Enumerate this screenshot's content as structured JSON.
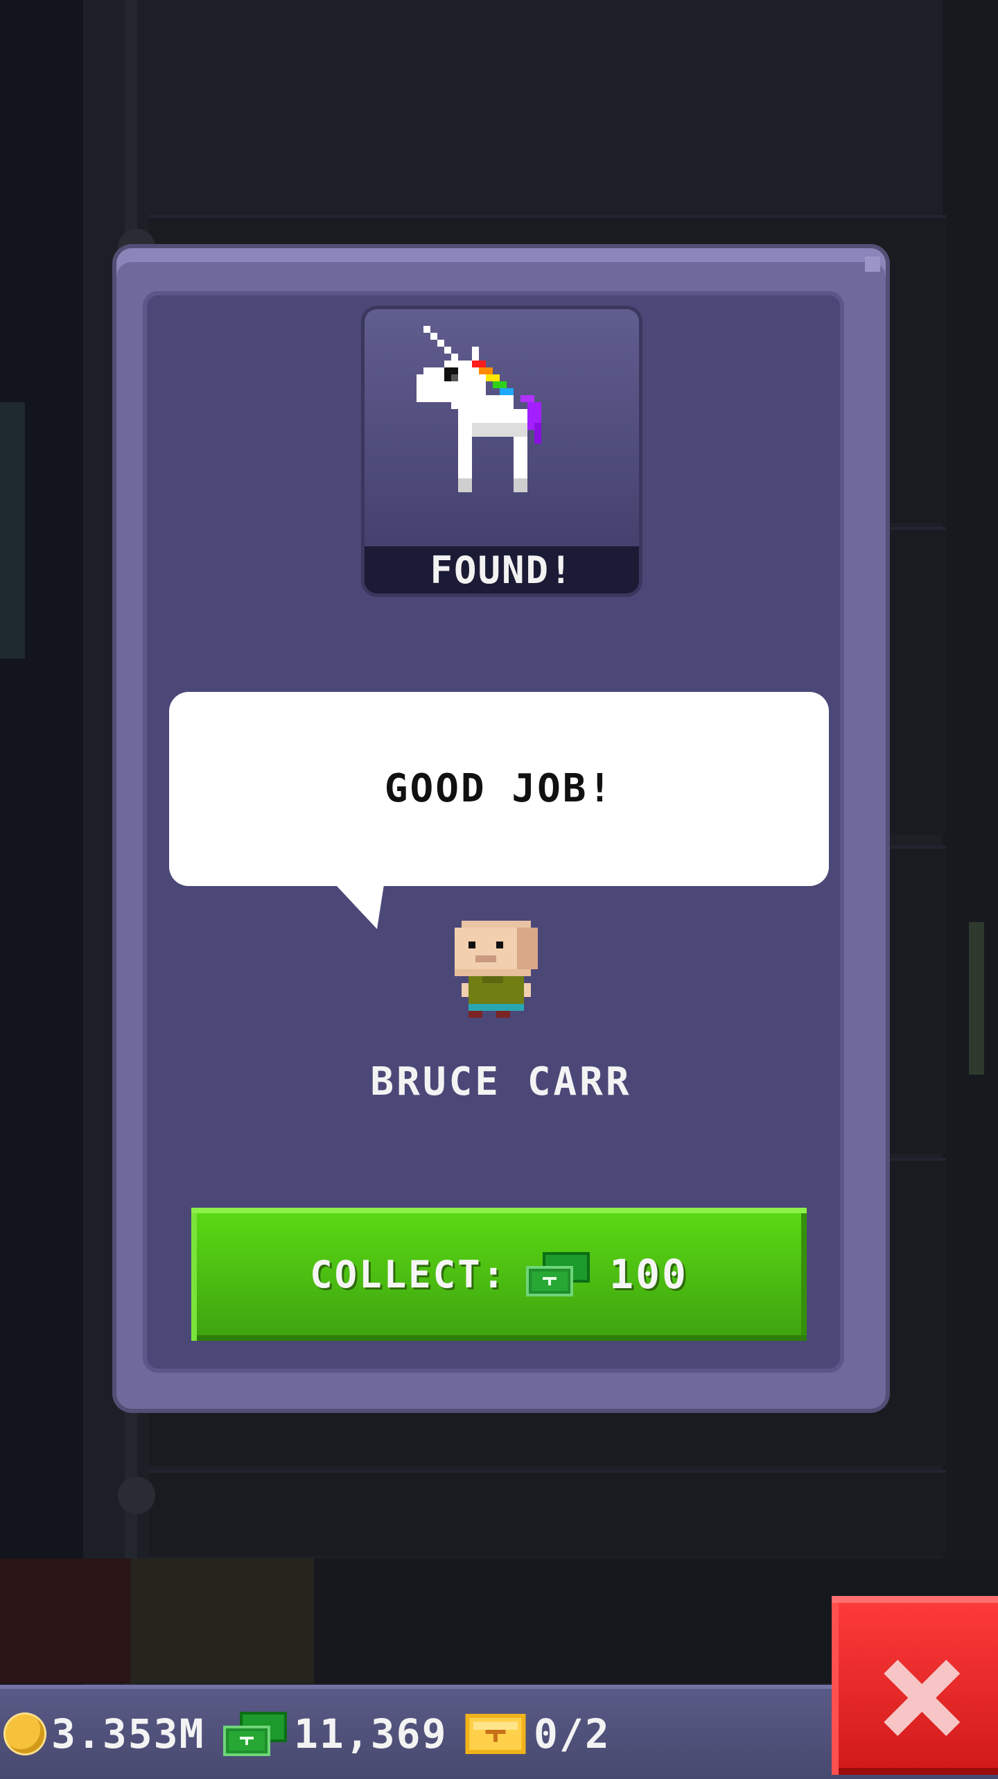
{
  "dialog": {
    "found_label": "FOUND!",
    "speech": "GOOD JOB!",
    "character_name": "BRUCE CARR",
    "collect_label": "COLLECT:",
    "collect_amount": "100"
  },
  "status_bar": {
    "coins": "3.353M",
    "bux": "11,369",
    "tickets": "0/2"
  },
  "colors": {
    "dialog_frame": "#6e6a9c",
    "dialog_inner": "#4b4878",
    "collect_button": "#4cc012",
    "close_button": "#e52323",
    "status_bar": "#525380"
  },
  "icons": {
    "reward": "unicorn-icon",
    "currency_coin": "coin-icon",
    "currency_bux": "bux-icon",
    "currency_ticket": "ticket-icon",
    "close": "close-icon"
  }
}
